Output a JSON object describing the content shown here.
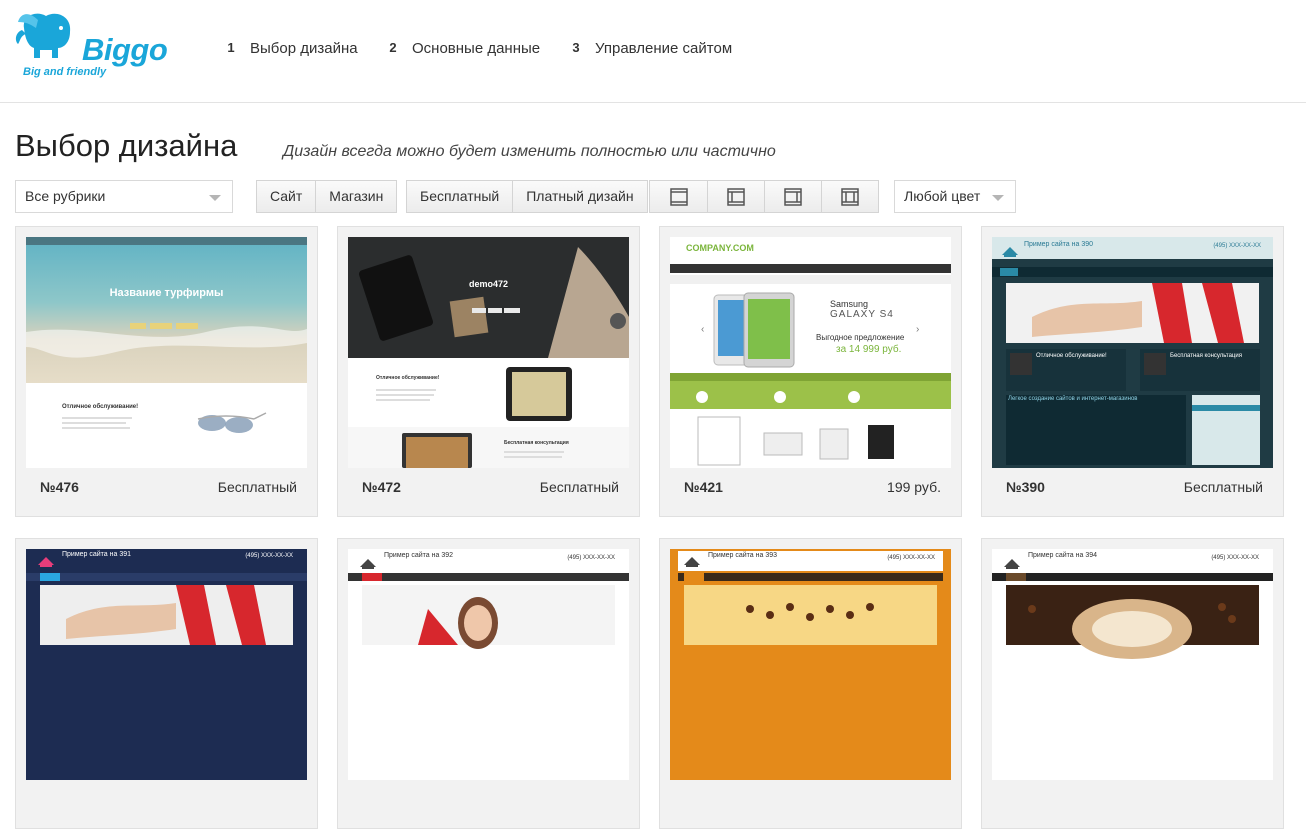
{
  "header": {
    "logo_name": "Biggo",
    "logo_tagline": "Big and friendly",
    "steps": [
      {
        "num": "1",
        "label": "Выбор дизайна",
        "active": true
      },
      {
        "num": "2",
        "label": "Основные данные",
        "active": false
      },
      {
        "num": "3",
        "label": "Управление сайтом",
        "active": false
      }
    ]
  },
  "page": {
    "title": "Выбор дизайна",
    "subtitle": "Дизайн всегда можно будет изменить полностью или частично"
  },
  "filters": {
    "category_select": "Все рубрики",
    "type_buttons": [
      "Сайт",
      "Магазин"
    ],
    "price_buttons": [
      "Бесплатный",
      "Платный дизайн"
    ],
    "layout_icons": [
      "layout-full-icon",
      "layout-left-sidebar-icon",
      "layout-right-sidebar-icon",
      "layout-two-sidebars-icon"
    ],
    "color_select": "Любой цвет"
  },
  "templates": [
    {
      "number": "№476",
      "price": "Бесплатный",
      "preview_title": "Название турфирмы",
      "preview_heading": "Отличное обслуживание!"
    },
    {
      "number": "№472",
      "price": "Бесплатный",
      "preview_title": "demo472",
      "preview_heading": "Отличное обслуживание!",
      "preview_heading2": "Бесплатная консультация"
    },
    {
      "number": "№421",
      "price": "199 руб.",
      "preview_title": "COMPANY.COM",
      "preview_brand": "Samsung",
      "preview_model": "GALAXY S4",
      "preview_offer": "Выгодное предложение",
      "preview_offer_price": "за 14 999 руб."
    },
    {
      "number": "№390",
      "price": "Бесплатный",
      "preview_title": "Пример сайта на 390",
      "preview_phone": "(495) XXX-XX-XX",
      "preview_heading": "Отличное обслуживание!",
      "preview_heading2": "Бесплатная консультация",
      "preview_body_title": "Легкое создание сайтов и интернет-магазинов"
    },
    {
      "number": "",
      "price": "",
      "preview_title": "Пример сайта на 391",
      "preview_phone": "(495) XXX-XX-XX"
    },
    {
      "number": "",
      "price": "",
      "preview_title": "Пример сайта на 392",
      "preview_phone": "(495) XXX-XX-XX"
    },
    {
      "number": "",
      "price": "",
      "preview_title": "Пример сайта на 393",
      "preview_phone": "(495) XXX-XX-XX"
    },
    {
      "number": "",
      "price": "",
      "preview_title": "Пример сайта на 394",
      "preview_phone": "(495) XXX-XX-XX"
    }
  ],
  "colors": {
    "accent_yellow": "#ffe100",
    "step_grey": "#ececec",
    "brand_blue": "#1aa6d9"
  }
}
